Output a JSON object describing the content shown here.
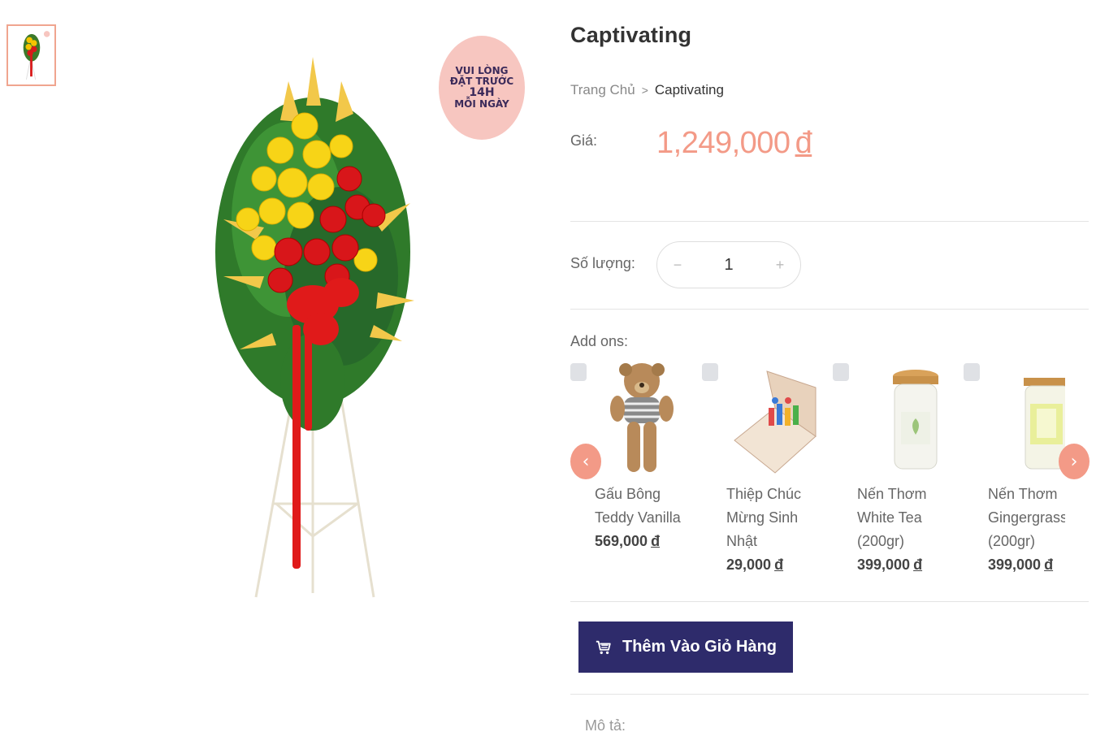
{
  "product": {
    "title": "Captivating",
    "badge": {
      "line1": "VUI LÒNG",
      "line2": "ĐẶT TRƯỚC",
      "line3": "14H",
      "line4": "MỖI NGÀY"
    }
  },
  "breadcrumb": {
    "home": "Trang Chủ",
    "separator": ">",
    "current": "Captivating"
  },
  "price": {
    "label": "Giá:",
    "amount": "1,249,000",
    "currency": "đ"
  },
  "quantity": {
    "label": "Số lượng:",
    "minus": "−",
    "value": "1",
    "plus": "+"
  },
  "addons": {
    "label": "Add ons:",
    "prev": "‹",
    "next": "›",
    "items": [
      {
        "name": "Gấu Bông Teddy Vanilla",
        "price": "569,000",
        "currency": "đ",
        "icon": "teddy-bear"
      },
      {
        "name": "Thiệp Chúc Mừng Sinh Nhật",
        "price": "29,000",
        "currency": "đ",
        "icon": "greeting-card"
      },
      {
        "name": "Nến Thơm White Tea (200gr)",
        "price": "399,000",
        "currency": "đ",
        "icon": "candle-jar"
      },
      {
        "name": "Nến Thơm Gingergrass (200gr)",
        "price": "399,000",
        "currency": "đ",
        "icon": "candle-jar-green"
      }
    ]
  },
  "cart": {
    "label": "Thêm Vào Giỏ Hàng",
    "icon": "cart-icon"
  },
  "description": {
    "label": "Mô tả:"
  },
  "colors": {
    "accent": "#f39a87",
    "button": "#2e2b6b",
    "badge": "#f7c6c0"
  }
}
